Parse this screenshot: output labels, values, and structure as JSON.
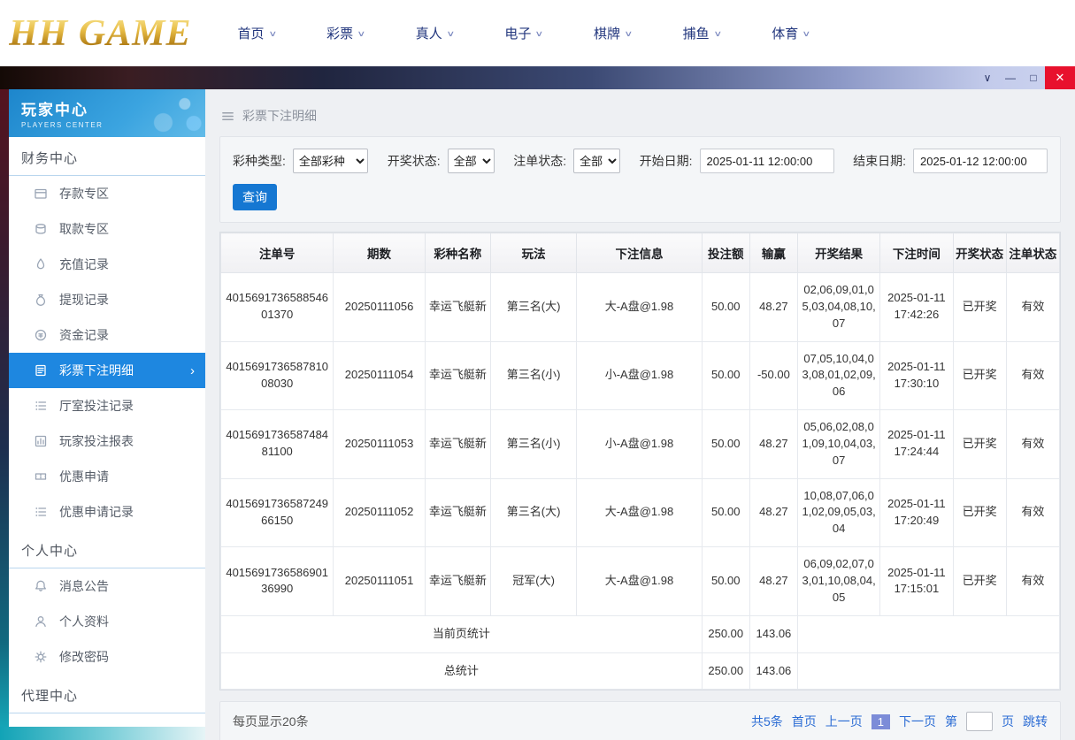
{
  "colors": {
    "accent_blue": "#1577d2",
    "active_item_blue": "#1e87e0",
    "sidebar_header_blue": "#2693d8",
    "close_red": "#e8112d",
    "logo_gold": "#d4a017",
    "teal": "#16aebf",
    "link_blue": "#2b6cd4",
    "current_page_bg": "#7c8cd8"
  },
  "top_nav": {
    "logo": "HH GAME",
    "items": [
      {
        "id": "home",
        "label": "首页"
      },
      {
        "id": "lottery",
        "label": "彩票"
      },
      {
        "id": "live",
        "label": "真人"
      },
      {
        "id": "electronic",
        "label": "电子"
      },
      {
        "id": "chess",
        "label": "棋牌"
      },
      {
        "id": "fishing",
        "label": "捕鱼"
      },
      {
        "id": "sports",
        "label": "体育"
      }
    ]
  },
  "titlebar": {
    "menu_icon": "∨",
    "minimize_icon": "—",
    "maximize_icon": "□",
    "close_icon": "✕"
  },
  "sidebar": {
    "title": "玩家中心",
    "subtitle": "PLAYERS CENTER",
    "sections": [
      {
        "id": "finance-center",
        "label": "财务中心",
        "items": [
          {
            "id": "deposit-zone",
            "label": "存款专区",
            "icon": "card-icon",
            "active": false
          },
          {
            "id": "withdraw-zone",
            "label": "取款专区",
            "icon": "coins-icon",
            "active": false
          },
          {
            "id": "recharge-record",
            "label": "充值记录",
            "icon": "droplet-icon",
            "active": false
          },
          {
            "id": "withdraw-record",
            "label": "提现记录",
            "icon": "moneybag-icon",
            "active": false
          },
          {
            "id": "funds-record",
            "label": "资金记录",
            "icon": "coin-icon",
            "active": false
          },
          {
            "id": "lottery-bet-detail",
            "label": "彩票下注明细",
            "icon": "document-icon",
            "active": true
          },
          {
            "id": "hall-bet-record",
            "label": "厅室投注记录",
            "icon": "list-icon",
            "active": false
          },
          {
            "id": "player-bet-report",
            "label": "玩家投注报表",
            "icon": "chart-icon",
            "active": false
          },
          {
            "id": "promo-apply",
            "label": "优惠申请",
            "icon": "ticket-icon",
            "active": false
          },
          {
            "id": "promo-apply-record",
            "label": "优惠申请记录",
            "icon": "list-icon",
            "active": false
          }
        ]
      },
      {
        "id": "personal-center",
        "label": "个人中心",
        "items": [
          {
            "id": "announcements",
            "label": "消息公告",
            "icon": "bell-icon",
            "active": false
          },
          {
            "id": "profile",
            "label": "个人资料",
            "icon": "user-icon",
            "active": false
          },
          {
            "id": "change-password",
            "label": "修改密码",
            "icon": "gear-icon",
            "active": false
          }
        ]
      },
      {
        "id": "agent-center",
        "label": "代理中心",
        "items": []
      }
    ]
  },
  "breadcrumb": {
    "title": "彩票下注明细"
  },
  "filters": {
    "lottery_type": {
      "label": "彩种类型:",
      "value": "全部彩种"
    },
    "draw_status": {
      "label": "开奖状态:",
      "value": "全部"
    },
    "order_status": {
      "label": "注单状态:",
      "value": "全部"
    },
    "start_date": {
      "label": "开始日期:",
      "value": "2025-01-11 12:00:00"
    },
    "end_date": {
      "label": "结束日期:",
      "value": "2025-01-12 12:00:00"
    },
    "search_button": "查询"
  },
  "table": {
    "headers": [
      "注单号",
      "期数",
      "彩种名称",
      "玩法",
      "下注信息",
      "投注额",
      "输赢",
      "开奖结果",
      "下注时间",
      "开奖状态",
      "注单状态"
    ],
    "rows": [
      [
        "401569173658854601370",
        "20250111056",
        "幸运飞艇新",
        "第三名(大)",
        "大-A盘@1.98",
        "50.00",
        "48.27",
        "02,06,09,01,05,03,04,08,10,07",
        "2025-01-11 17:42:26",
        "已开奖",
        "有效"
      ],
      [
        "401569173658781008030",
        "20250111054",
        "幸运飞艇新",
        "第三名(小)",
        "小-A盘@1.98",
        "50.00",
        "-50.00",
        "07,05,10,04,03,08,01,02,09,06",
        "2025-01-11 17:30:10",
        "已开奖",
        "有效"
      ],
      [
        "401569173658748481100",
        "20250111053",
        "幸运飞艇新",
        "第三名(小)",
        "小-A盘@1.98",
        "50.00",
        "48.27",
        "05,06,02,08,01,09,10,04,03,07",
        "2025-01-11 17:24:44",
        "已开奖",
        "有效"
      ],
      [
        "401569173658724966150",
        "20250111052",
        "幸运飞艇新",
        "第三名(大)",
        "大-A盘@1.98",
        "50.00",
        "48.27",
        "10,08,07,06,01,02,09,05,03,04",
        "2025-01-11 17:20:49",
        "已开奖",
        "有效"
      ],
      [
        "401569173658690136990",
        "20250111051",
        "幸运飞艇新",
        "冠军(大)",
        "大-A盘@1.98",
        "50.00",
        "48.27",
        "06,09,02,07,03,01,10,08,04,05",
        "2025-01-11 17:15:01",
        "已开奖",
        "有效"
      ]
    ],
    "summary": [
      {
        "label": "当前页统计",
        "bet": "250.00",
        "winloss": "143.06"
      },
      {
        "label": "总统计",
        "bet": "250.00",
        "winloss": "143.06"
      }
    ]
  },
  "pagination": {
    "page_size": "每页显示20条",
    "total": "共5条",
    "first": "首页",
    "prev": "上一页",
    "current": "1",
    "next": "下一页",
    "jump_prefix": "第",
    "jump_suffix": "页",
    "jump_button": "跳转"
  }
}
